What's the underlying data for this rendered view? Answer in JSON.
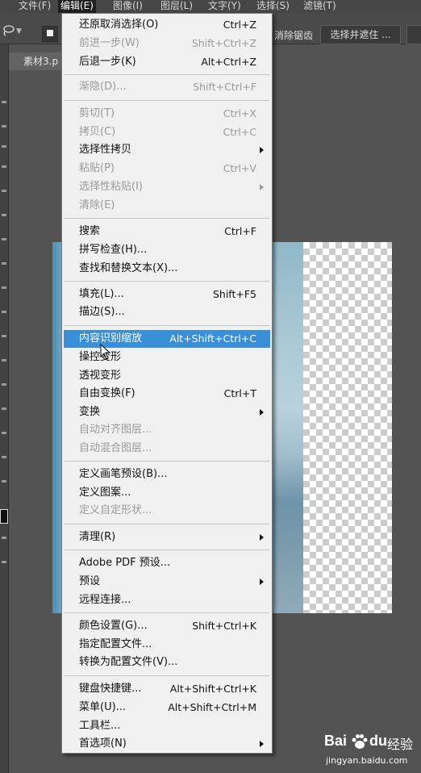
{
  "menubar": {
    "items": [
      "文件(F)",
      "编辑(E)",
      "图像(I)",
      "图层(L)",
      "文字(Y)",
      "选择(S)",
      "滤镜(T)"
    ]
  },
  "options_bar": {
    "anti_alias_label": "消除锯齿",
    "select_and_mask_label": "选择并遮住 ..."
  },
  "document_tab": {
    "title": "素材3.p"
  },
  "edit_menu": {
    "items": [
      {
        "label": "还原取消选择(O)",
        "shortcut": "Ctrl+Z"
      },
      {
        "label": "前进一步(W)",
        "shortcut": "Shift+Ctrl+Z"
      },
      {
        "label": "后退一步(K)",
        "shortcut": "Alt+Ctrl+Z"
      },
      {
        "label": "渐隐(D)...",
        "shortcut": "Shift+Ctrl+F"
      },
      {
        "label": "剪切(T)",
        "shortcut": "Ctrl+X"
      },
      {
        "label": "拷贝(C)",
        "shortcut": "Ctrl+C"
      },
      {
        "label": "选择性拷贝",
        "shortcut": ""
      },
      {
        "label": "粘贴(P)",
        "shortcut": "Ctrl+V"
      },
      {
        "label": "选择性粘贴(I)",
        "shortcut": ""
      },
      {
        "label": "清除(E)",
        "shortcut": ""
      },
      {
        "label": "搜索",
        "shortcut": "Ctrl+F"
      },
      {
        "label": "拼写检查(H)...",
        "shortcut": ""
      },
      {
        "label": "查找和替换文本(X)...",
        "shortcut": ""
      },
      {
        "label": "填充(L)...",
        "shortcut": "Shift+F5"
      },
      {
        "label": "描边(S)...",
        "shortcut": ""
      },
      {
        "label": "内容识别缩放",
        "shortcut": "Alt+Shift+Ctrl+C"
      },
      {
        "label": "操控变形",
        "shortcut": ""
      },
      {
        "label": "透视变形",
        "shortcut": ""
      },
      {
        "label": "自由变换(F)",
        "shortcut": "Ctrl+T"
      },
      {
        "label": "变换",
        "shortcut": ""
      },
      {
        "label": "自动对齐图层...",
        "shortcut": ""
      },
      {
        "label": "自动混合图层...",
        "shortcut": ""
      },
      {
        "label": "定义画笔预设(B)...",
        "shortcut": ""
      },
      {
        "label": "定义图案...",
        "shortcut": ""
      },
      {
        "label": "定义自定形状...",
        "shortcut": ""
      },
      {
        "label": "清理(R)",
        "shortcut": ""
      },
      {
        "label": "Adobe PDF 预设...",
        "shortcut": ""
      },
      {
        "label": "预设",
        "shortcut": ""
      },
      {
        "label": "远程连接...",
        "shortcut": ""
      },
      {
        "label": "颜色设置(G)...",
        "shortcut": "Shift+Ctrl+K"
      },
      {
        "label": "指定配置文件...",
        "shortcut": ""
      },
      {
        "label": "转换为配置文件(V)...",
        "shortcut": ""
      },
      {
        "label": "键盘快捷键...",
        "shortcut": "Alt+Shift+Ctrl+K"
      },
      {
        "label": "菜单(U)...",
        "shortcut": "Alt+Shift+Ctrl+M"
      },
      {
        "label": "工具栏...",
        "shortcut": ""
      },
      {
        "label": "首选项(N)",
        "shortcut": ""
      }
    ]
  },
  "watermark": {
    "bai": "Bai",
    "du": "du",
    "jingyan": "经验",
    "url": "jingyan.baidu.com"
  }
}
